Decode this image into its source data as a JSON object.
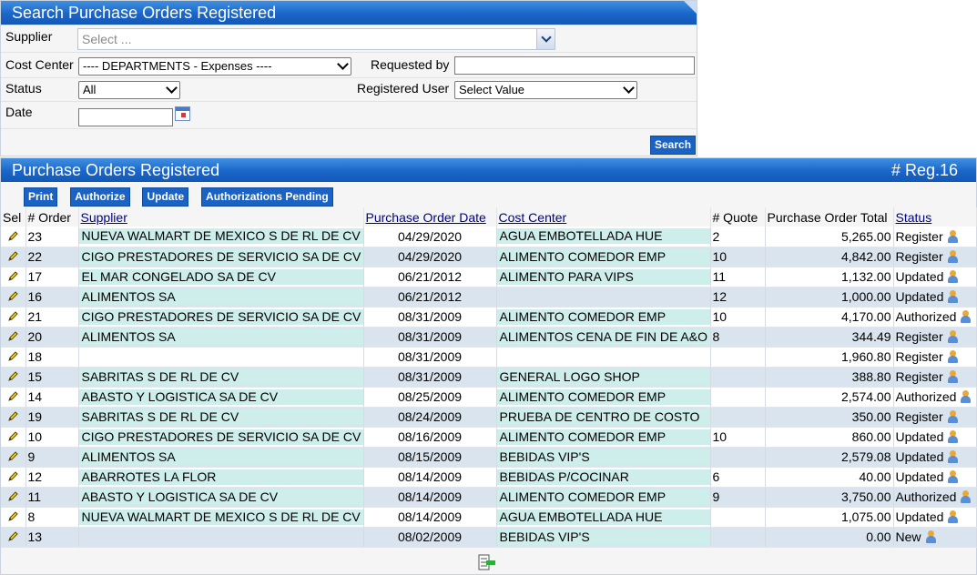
{
  "search": {
    "title": "Search Purchase Orders Registered",
    "supplier_label": "Supplier",
    "supplier_placeholder": "Select ...",
    "cost_center_label": "Cost Center",
    "cost_center_value": "---- DEPARTMENTS - Expenses ----",
    "requested_by_label": "Requested by",
    "requested_by_value": "",
    "status_label": "Status",
    "status_value": "All",
    "registered_user_label": "Registered User",
    "registered_user_value": "Select Value",
    "date_label": "Date",
    "date_value": "",
    "search_button": "Search"
  },
  "results": {
    "title": "Purchase Orders Registered",
    "count": "# Reg.16",
    "toolbar": [
      "Print",
      "Authorize",
      "Update",
      "Authorizations Pending"
    ],
    "columns": [
      "Sel",
      "# Order",
      "Supplier",
      "Purchase Order Date",
      "Cost Center",
      "# Quote",
      "Purchase Order Total",
      "Status"
    ],
    "rows": [
      {
        "order": "23",
        "supplier": "NUEVA WALMART DE MEXICO S DE RL DE CV",
        "date": "04/29/2020",
        "cost_center": "AGUA EMBOTELLADA HUE",
        "quote": "2",
        "total": "5,265.00",
        "status": "Register"
      },
      {
        "order": "22",
        "supplier": "CIGO PRESTADORES DE SERVICIO SA DE CV",
        "date": "04/29/2020",
        "cost_center": "ALIMENTO COMEDOR EMP",
        "quote": "10",
        "total": "4,842.00",
        "status": "Register"
      },
      {
        "order": "17",
        "supplier": "EL MAR CONGELADO SA DE CV",
        "date": "06/21/2012",
        "cost_center": "ALIMENTO PARA VIPS",
        "quote": "11",
        "total": "1,132.00",
        "status": "Updated"
      },
      {
        "order": "16",
        "supplier": "ALIMENTOS SA",
        "date": "06/21/2012",
        "cost_center": "",
        "quote": "12",
        "total": "1,000.00",
        "status": "Updated"
      },
      {
        "order": "21",
        "supplier": "CIGO PRESTADORES DE SERVICIO SA DE CV",
        "date": "08/31/2009",
        "cost_center": "ALIMENTO COMEDOR EMP",
        "quote": "10",
        "total": "4,170.00",
        "status": "Authorized"
      },
      {
        "order": "20",
        "supplier": "ALIMENTOS SA",
        "date": "08/31/2009",
        "cost_center": "ALIMENTOS CENA DE FIN DE A&O",
        "quote": "8",
        "total": "344.49",
        "status": "Register"
      },
      {
        "order": "18",
        "supplier": "",
        "date": "08/31/2009",
        "cost_center": "",
        "quote": "",
        "total": "1,960.80",
        "status": "Register"
      },
      {
        "order": "15",
        "supplier": "SABRITAS S DE RL DE CV",
        "date": "08/31/2009",
        "cost_center": "GENERAL LOGO SHOP",
        "quote": "",
        "total": "388.80",
        "status": "Register"
      },
      {
        "order": "14",
        "supplier": "ABASTO Y LOGISTICA SA DE CV",
        "date": "08/25/2009",
        "cost_center": "ALIMENTO COMEDOR EMP",
        "quote": "",
        "total": "2,574.00",
        "status": "Authorized"
      },
      {
        "order": "19",
        "supplier": "SABRITAS S DE RL DE CV",
        "date": "08/24/2009",
        "cost_center": "PRUEBA DE CENTRO DE COSTO",
        "quote": "",
        "total": "350.00",
        "status": "Register"
      },
      {
        "order": "10",
        "supplier": "CIGO PRESTADORES DE SERVICIO SA DE CV",
        "date": "08/16/2009",
        "cost_center": "ALIMENTO COMEDOR EMP",
        "quote": "10",
        "total": "860.00",
        "status": "Updated"
      },
      {
        "order": "9",
        "supplier": "ALIMENTOS SA",
        "date": "08/15/2009",
        "cost_center": "BEBIDAS VIP'S",
        "quote": "",
        "total": "2,579.08",
        "status": "Updated"
      },
      {
        "order": "12",
        "supplier": "ABARROTES LA FLOR",
        "date": "08/14/2009",
        "cost_center": "BEBIDAS P/COCINAR",
        "quote": "6",
        "total": "40.00",
        "status": "Updated"
      },
      {
        "order": "11",
        "supplier": "ABASTO Y LOGISTICA SA DE CV",
        "date": "08/14/2009",
        "cost_center": "ALIMENTO COMEDOR EMP",
        "quote": "9",
        "total": "3,750.00",
        "status": "Authorized"
      },
      {
        "order": "8",
        "supplier": "NUEVA WALMART DE MEXICO S DE RL DE CV",
        "date": "08/14/2009",
        "cost_center": "AGUA EMBOTELLADA HUE",
        "quote": "",
        "total": "1,075.00",
        "status": "Updated"
      },
      {
        "order": "13",
        "supplier": "",
        "date": "08/02/2009",
        "cost_center": "BEBIDAS VIP'S",
        "quote": "",
        "total": "0.00",
        "status": "New"
      }
    ]
  },
  "colors": {
    "header_blue": "#1a66c9",
    "row_alt": "#d9e4ef",
    "cell_highlight": "#cdeeea",
    "link_text": "#00008b"
  },
  "icons": {
    "row_select": "pencil-icon",
    "status": "user-icon",
    "date_picker": "calendar-icon",
    "footer": "export-icon"
  }
}
